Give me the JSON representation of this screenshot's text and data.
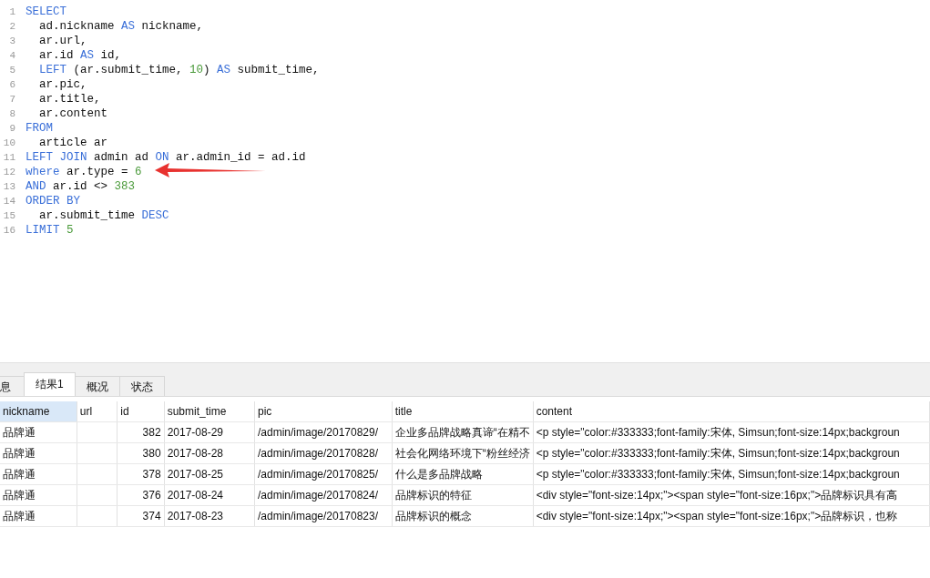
{
  "editor": {
    "lines": [
      {
        "number": "1",
        "tokens": [
          {
            "text": "SELECT",
            "kind": "keyword"
          }
        ]
      },
      {
        "number": "2",
        "tokens": [
          {
            "text": "  ad.nickname ",
            "kind": "plain"
          },
          {
            "text": "AS",
            "kind": "keyword"
          },
          {
            "text": " nickname,",
            "kind": "plain"
          }
        ]
      },
      {
        "number": "3",
        "tokens": [
          {
            "text": "  ar.url,",
            "kind": "plain"
          }
        ]
      },
      {
        "number": "4",
        "tokens": [
          {
            "text": "  ar.id ",
            "kind": "plain"
          },
          {
            "text": "AS",
            "kind": "keyword"
          },
          {
            "text": " id,",
            "kind": "plain"
          }
        ]
      },
      {
        "number": "5",
        "tokens": [
          {
            "text": "  LEFT",
            "kind": "keyword"
          },
          {
            "text": " (ar.submit_time, ",
            "kind": "plain"
          },
          {
            "text": "10",
            "kind": "number"
          },
          {
            "text": ") ",
            "kind": "plain"
          },
          {
            "text": "AS",
            "kind": "keyword"
          },
          {
            "text": " submit_time,",
            "kind": "plain"
          }
        ]
      },
      {
        "number": "6",
        "tokens": [
          {
            "text": "  ar.pic,",
            "kind": "plain"
          }
        ]
      },
      {
        "number": "7",
        "tokens": [
          {
            "text": "  ar.title,",
            "kind": "plain"
          }
        ]
      },
      {
        "number": "8",
        "tokens": [
          {
            "text": "  ar.content",
            "kind": "plain"
          }
        ]
      },
      {
        "number": "9",
        "tokens": [
          {
            "text": "FROM",
            "kind": "keyword"
          }
        ]
      },
      {
        "number": "10",
        "tokens": [
          {
            "text": "  article ar",
            "kind": "plain"
          }
        ]
      },
      {
        "number": "11",
        "tokens": [
          {
            "text": "LEFT JOIN",
            "kind": "keyword"
          },
          {
            "text": " admin ad ",
            "kind": "plain"
          },
          {
            "text": "ON",
            "kind": "keyword"
          },
          {
            "text": " ar.admin_id = ad.id",
            "kind": "plain"
          }
        ]
      },
      {
        "number": "12",
        "tokens": [
          {
            "text": "where",
            "kind": "keyword"
          },
          {
            "text": " ar.type = ",
            "kind": "plain"
          },
          {
            "text": "6",
            "kind": "number"
          }
        ]
      },
      {
        "number": "13",
        "tokens": [
          {
            "text": "AND",
            "kind": "keyword"
          },
          {
            "text": " ar.id <> ",
            "kind": "plain"
          },
          {
            "text": "383",
            "kind": "number"
          }
        ]
      },
      {
        "number": "14",
        "tokens": [
          {
            "text": "ORDER BY",
            "kind": "keyword"
          }
        ]
      },
      {
        "number": "15",
        "tokens": [
          {
            "text": "  ar.submit_time ",
            "kind": "plain"
          },
          {
            "text": "DESC",
            "kind": "keyword"
          }
        ]
      },
      {
        "number": "16",
        "tokens": [
          {
            "text": "LIMIT ",
            "kind": "keyword"
          },
          {
            "text": "5",
            "kind": "number"
          }
        ]
      }
    ]
  },
  "tabs": [
    {
      "label": "息",
      "selected": false
    },
    {
      "label": "结果1",
      "selected": true
    },
    {
      "label": "概况",
      "selected": false
    },
    {
      "label": "状态",
      "selected": false
    }
  ],
  "table": {
    "columns": [
      {
        "label": "nickname",
        "selected": true
      },
      {
        "label": "url",
        "selected": false
      },
      {
        "label": "id",
        "selected": false
      },
      {
        "label": "submit_time",
        "selected": false
      },
      {
        "label": "pic",
        "selected": false
      },
      {
        "label": "title",
        "selected": false
      },
      {
        "label": "content",
        "selected": false
      }
    ],
    "rows": [
      [
        "品牌通",
        "",
        "382",
        "2017-08-29",
        "/admin/image/20170829/",
        "企业多品牌战略真谛“在精不",
        "<p style=\"color:#333333;font-family:宋体, Simsun;font-size:14px;backgroun"
      ],
      [
        "品牌通",
        "",
        "380",
        "2017-08-28",
        "/admin/image/20170828/",
        "社会化网络环境下“粉丝经济",
        "<p style=\"color:#333333;font-family:宋体, Simsun;font-size:14px;backgroun"
      ],
      [
        "品牌通",
        "",
        "378",
        "2017-08-25",
        "/admin/image/20170825/",
        "什么是多品牌战略",
        "<p style=\"color:#333333;font-family:宋体, Simsun;font-size:14px;backgroun"
      ],
      [
        "品牌通",
        "",
        "376",
        "2017-08-24",
        "/admin/image/20170824/",
        "品牌标识的特征",
        "<div style=\"font-size:14px;\"><span style=\"font-size:16px;\">品牌标识具有高"
      ],
      [
        "品牌通",
        "",
        "374",
        "2017-08-23",
        "/admin/image/20170823/",
        "品牌标识的概念",
        "<div style=\"font-size:14px;\"><span style=\"font-size:16px;\">品牌标识，也称"
      ]
    ]
  }
}
